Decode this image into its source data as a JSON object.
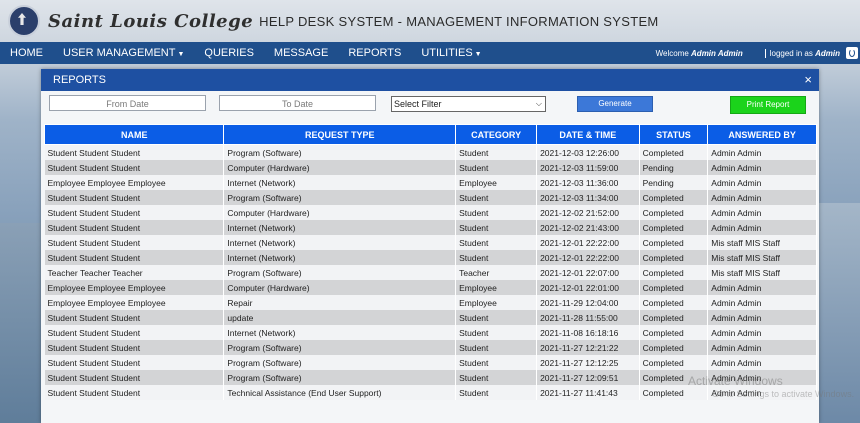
{
  "header": {
    "college_name": "Saint Louis College",
    "system_title": "HELP DESK SYSTEM - MANAGEMENT INFORMATION SYSTEM"
  },
  "nav": {
    "items": [
      {
        "label": "HOME",
        "dropdown": false
      },
      {
        "label": "USER MANAGEMENT",
        "dropdown": true
      },
      {
        "label": "QUERIES",
        "dropdown": false
      },
      {
        "label": "MESSAGE",
        "dropdown": false
      },
      {
        "label": "REPORTS",
        "dropdown": false
      },
      {
        "label": "UTILITIES",
        "dropdown": true
      }
    ],
    "welcome_prefix": "Welcome ",
    "welcome_user": "Admin Admin",
    "logged_prefix": "logged in as ",
    "logged_user": "Admin"
  },
  "modal": {
    "title": "REPORTS",
    "close": "×",
    "from_date_placeholder": "From Date",
    "to_date_placeholder": "To Date",
    "filter_selected": "Select Filter",
    "generate_label": "Generate",
    "print_label": "Print Report"
  },
  "table": {
    "columns": [
      "NAME",
      "REQUEST TYPE",
      "CATEGORY",
      "DATE & TIME",
      "STATUS",
      "ANSWERED BY"
    ],
    "rows": [
      [
        "Student Student Student",
        "Program (Software)",
        "Student",
        "2021-12-03 12:26:00",
        "Completed",
        "Admin Admin"
      ],
      [
        "Student Student Student",
        "Computer (Hardware)",
        "Student",
        "2021-12-03 11:59:00",
        "Pending",
        "Admin Admin"
      ],
      [
        "Employee Employee Employee",
        "Internet (Network)",
        "Employee",
        "2021-12-03 11:36:00",
        "Pending",
        "Admin Admin"
      ],
      [
        "Student Student Student",
        "Program (Software)",
        "Student",
        "2021-12-03 11:34:00",
        "Completed",
        "Admin Admin"
      ],
      [
        "Student Student Student",
        "Computer (Hardware)",
        "Student",
        "2021-12-02 21:52:00",
        "Completed",
        "Admin Admin"
      ],
      [
        "Student Student Student",
        "Internet (Network)",
        "Student",
        "2021-12-02 21:43:00",
        "Completed",
        "Admin Admin"
      ],
      [
        "Student Student Student",
        "Internet (Network)",
        "Student",
        "2021-12-01 22:22:00",
        "Completed",
        "Mis staff MIS Staff"
      ],
      [
        "Student Student Student",
        "Internet (Network)",
        "Student",
        "2021-12-01 22:22:00",
        "Completed",
        "Mis staff MIS Staff"
      ],
      [
        "Teacher Teacher Teacher",
        "Program (Software)",
        "Teacher",
        "2021-12-01 22:07:00",
        "Completed",
        "Mis staff MIS Staff"
      ],
      [
        "Employee Employee Employee",
        "Computer (Hardware)",
        "Employee",
        "2021-12-01 22:01:00",
        "Completed",
        "Admin Admin"
      ],
      [
        "Employee Employee Employee",
        "Repair",
        "Employee",
        "2021-11-29 12:04:00",
        "Completed",
        "Admin Admin"
      ],
      [
        "Student Student Student",
        "update",
        "Student",
        "2021-11-28 11:55:00",
        "Completed",
        "Admin Admin"
      ],
      [
        "Student Student Student",
        "Internet (Network)",
        "Student",
        "2021-11-08 16:18:16",
        "Completed",
        "Admin Admin"
      ],
      [
        "Student Student Student",
        "Program (Software)",
        "Student",
        "2021-11-27 12:21:22",
        "Completed",
        "Admin Admin"
      ],
      [
        "Student Student Student",
        "Program (Software)",
        "Student",
        "2021-11-27 12:12:25",
        "Completed",
        "Admin Admin"
      ],
      [
        "Student Student Student",
        "Program (Software)",
        "Student",
        "2021-11-27 12:09:51",
        "Completed",
        "Admin Admin"
      ],
      [
        "Student Student Student",
        "Technical Assistance (End User Support)",
        "Student",
        "2021-11-27 11:41:43",
        "Completed",
        "Admin Admin"
      ]
    ]
  },
  "watermark": {
    "line1": "Activate Windows",
    "line2": "Go to Settings to activate Windows."
  }
}
